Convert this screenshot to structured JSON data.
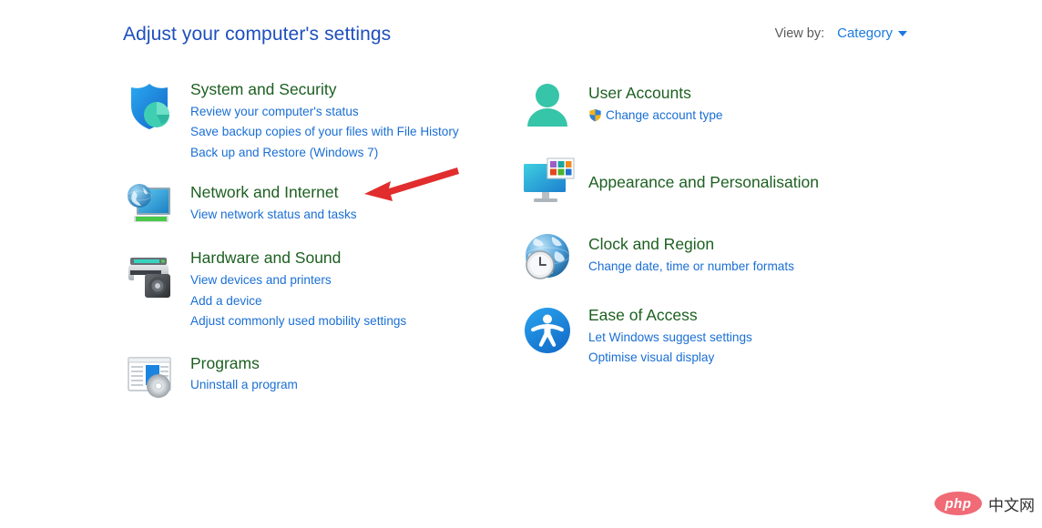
{
  "header": {
    "title": "Adjust your computer's settings",
    "view_by_label": "View by:",
    "view_by_value": "Category"
  },
  "colors": {
    "title_blue": "#1d4fbd",
    "category_green": "#1d6021",
    "link_blue": "#1a6fd4",
    "accent_blue": "#1a7ae0",
    "annotation_red": "#e12d2d",
    "watermark_pink": "#f06b76"
  },
  "categories": {
    "left": [
      {
        "id": "system",
        "icon": "shield-pie-icon",
        "title": "System and Security",
        "links": [
          "Review your computer's status",
          "Save backup copies of your files with File History",
          "Back up and Restore (Windows 7)"
        ]
      },
      {
        "id": "network",
        "icon": "network-monitor-globe-icon",
        "title": "Network and Internet",
        "links": [
          "View network status and tasks"
        ]
      },
      {
        "id": "hardware",
        "icon": "printer-speaker-icon",
        "title": "Hardware and Sound",
        "links": [
          "View devices and printers",
          "Add a device",
          "Adjust commonly used mobility settings"
        ]
      },
      {
        "id": "programs",
        "icon": "program-window-disc-icon",
        "title": "Programs",
        "links": [
          "Uninstall a program"
        ]
      }
    ],
    "right": [
      {
        "id": "useracct",
        "icon": "user-person-icon",
        "title": "User Accounts",
        "links": [
          "Change account type"
        ],
        "link_shield": true
      },
      {
        "id": "appear",
        "icon": "monitor-colorgrid-icon",
        "title": "Appearance and Personalisation",
        "links": []
      },
      {
        "id": "clock",
        "icon": "globe-clock-icon",
        "title": "Clock and Region",
        "links": [
          "Change date, time or number formats"
        ]
      },
      {
        "id": "access",
        "icon": "accessibility-person-icon",
        "title": "Ease of Access",
        "links": [
          "Let Windows suggest settings",
          "Optimise visual display"
        ]
      }
    ]
  },
  "annotation": {
    "type": "arrow",
    "color": "#e12d2d",
    "points_to": "Network and Internet"
  },
  "watermark": {
    "logo_text": "php",
    "site_text": "中文网"
  }
}
